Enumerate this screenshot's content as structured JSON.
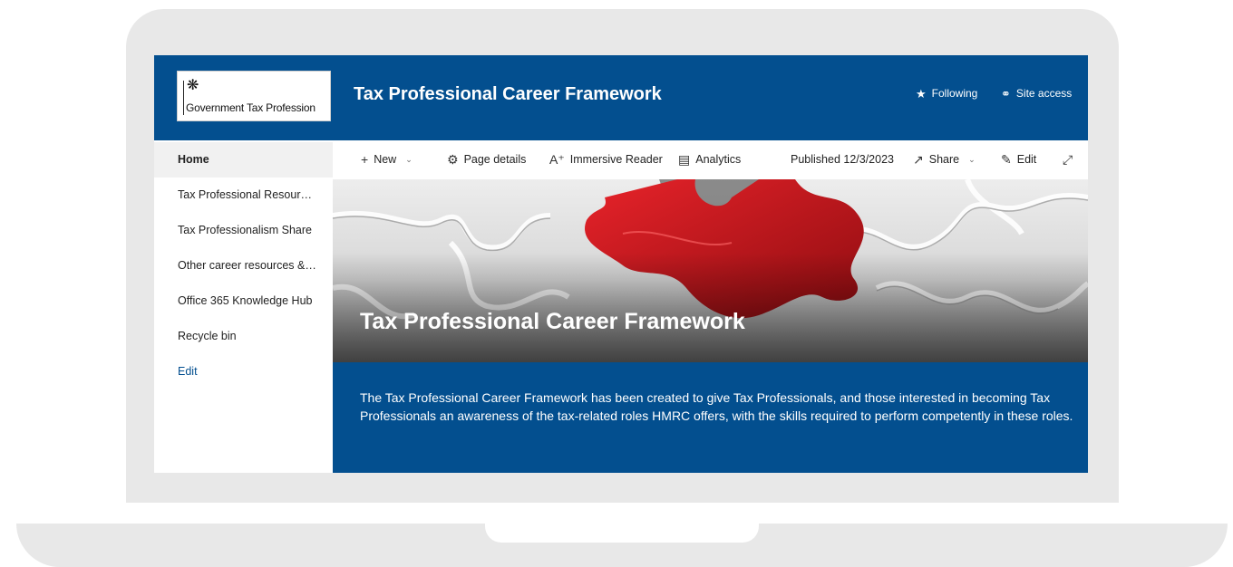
{
  "header": {
    "logo_text": "Government Tax Profession",
    "logo_crest": "crest-icon",
    "site_title": "Tax Professional Career Framework",
    "following_label": "Following",
    "following_icon": "star-icon",
    "site_access_label": "Site access",
    "site_access_icon": "people-icon"
  },
  "sidebar": {
    "items": [
      {
        "label": "Home",
        "active": true
      },
      {
        "label": "Tax Professional Resources"
      },
      {
        "label": "Tax Professionalism Share"
      },
      {
        "label": "Other career resources & links"
      },
      {
        "label": "Office 365 Knowledge Hub"
      },
      {
        "label": "Recycle bin"
      },
      {
        "label": "Edit"
      }
    ]
  },
  "toolbar": {
    "new_label": "New",
    "page_details_label": "Page details",
    "immersive_reader_label": "Immersive Reader",
    "analytics_label": "Analytics",
    "published_label": "Published 12/3/2023",
    "share_label": "Share",
    "edit_label": "Edit"
  },
  "hero": {
    "title": "Tax Professional Career Framework"
  },
  "description": {
    "text": "The Tax Professional Career Framework has been created to give Tax Professionals, and those interested in becoming Tax Professionals an awareness of the tax-related roles HMRC offers, with the skills required to perform competently in these roles."
  },
  "colors": {
    "brand_blue": "#034f8f",
    "puzzle_red": "#c8161d"
  }
}
